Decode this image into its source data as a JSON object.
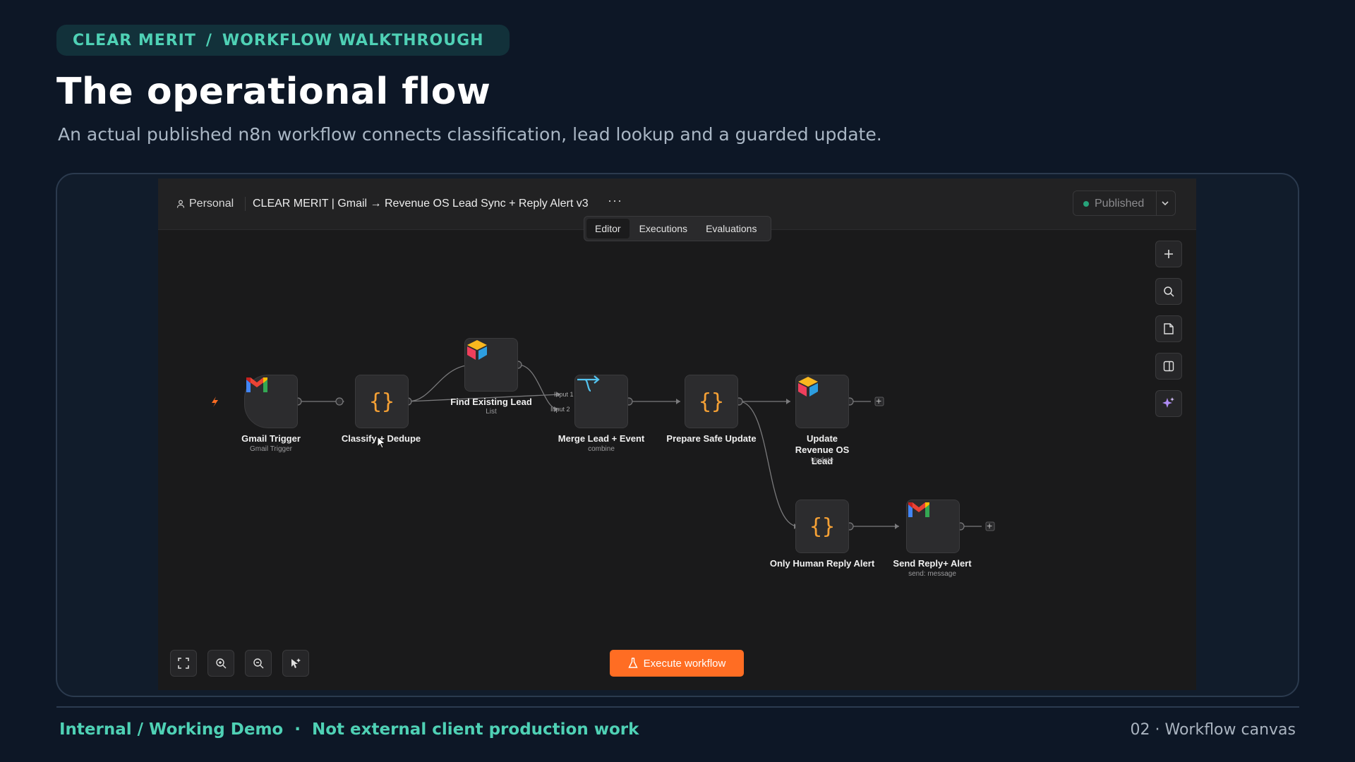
{
  "header": {
    "brand": "CLEAR MERIT",
    "breadcrumb_sep": "/",
    "section": "WORKFLOW WALKTHROUGH",
    "title": "The operational flow",
    "subtitle": "An actual published n8n workflow connects classification, lead lookup and a guarded update."
  },
  "app": {
    "topbar": {
      "project": "Personal",
      "workflow_name": "CLEAR MERIT | Gmail → Revenue OS Lead Sync + Reply Alert v3",
      "more": "···",
      "status": "Published"
    },
    "tabs": [
      {
        "label": "Editor",
        "active": true
      },
      {
        "label": "Executions",
        "active": false
      },
      {
        "label": "Evaluations",
        "active": false
      }
    ],
    "nodes": [
      {
        "id": "gmail-trigger",
        "label": "Gmail Trigger",
        "sub": "Gmail Trigger",
        "icon": "gmail-icon"
      },
      {
        "id": "classify-dedupe",
        "label": "Classify + Dedupe",
        "sub": "",
        "icon": "code-braces-icon"
      },
      {
        "id": "find-existing-lead",
        "label": "Find Existing Lead",
        "sub": "List",
        "icon": "revenue-os-cube-icon"
      },
      {
        "id": "merge-lead-event",
        "label": "Merge Lead + Event",
        "sub": "combine",
        "icon": "merge-icon"
      },
      {
        "id": "prepare-safe-update",
        "label": "Prepare Safe Update",
        "sub": "",
        "icon": "code-braces-icon"
      },
      {
        "id": "update-revenue-os-lead",
        "label": "Update Revenue OS Lead",
        "sub": "Update",
        "icon": "revenue-os-cube-icon"
      },
      {
        "id": "only-human-reply-alert",
        "label": "Only Human Reply Alert",
        "sub": "",
        "icon": "code-braces-icon"
      },
      {
        "id": "send-reply-alert",
        "label": "Send Reply+ Alert",
        "sub": "send: message",
        "icon": "gmail-icon"
      }
    ],
    "merge_inputs": [
      "Input 1",
      "Input 2"
    ],
    "right_tools": [
      "plus-icon",
      "search-icon",
      "sticky-note-icon",
      "panel-icon",
      "ai-sparkle-icon"
    ],
    "bottom_tools": [
      "fit-view-icon",
      "zoom-in-icon",
      "zoom-out-icon",
      "tidy-up-icon"
    ],
    "execute_button": "Execute workflow"
  },
  "footer": {
    "left_primary": "Internal / Working Demo",
    "left_sep": "·",
    "left_secondary": "Not external client production work",
    "right": "02 · Workflow canvas"
  },
  "colors": {
    "background": "#0d1726",
    "accent": "#4fd1b5",
    "execute": "#ff6d23",
    "code_node": "#f6a135"
  }
}
